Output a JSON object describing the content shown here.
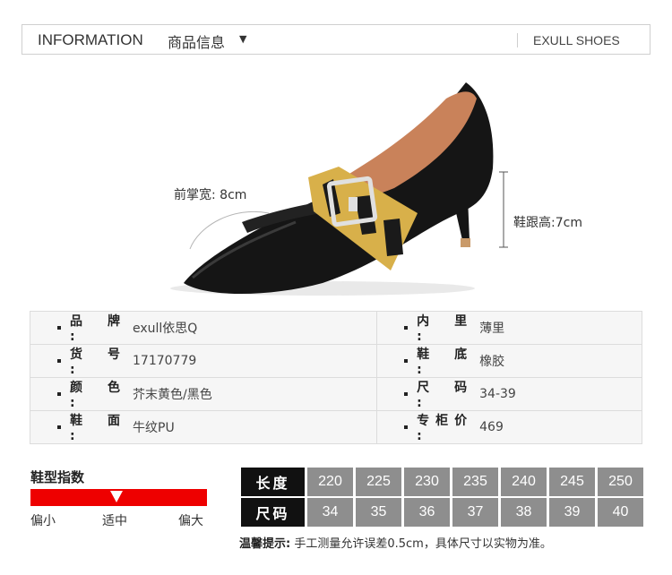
{
  "header": {
    "title_en": "INFORMATION",
    "title_cn": "商品信息",
    "caret": "▼",
    "brand": "EXULL SHOES"
  },
  "product": {
    "forefoot_label": "前掌宽: 8cm",
    "heel_label": "鞋跟高:7cm",
    "colors": {
      "leather": "#151515",
      "lining": "#c9825a",
      "buckle": "#d8b04a",
      "heel_tip": "#c99a6a"
    }
  },
  "info": {
    "rows": [
      {
        "left_key": "品 牌",
        "left_value": "exull依思Q",
        "right_key": "内 里",
        "right_value": "薄里"
      },
      {
        "left_key": "货 号",
        "left_value": "17170779",
        "right_key": "鞋 底",
        "right_value": "橡胶"
      },
      {
        "left_key": "颜 色",
        "left_value": "芥末黄色/黑色",
        "right_key": "尺 码",
        "right_value": "34-39"
      },
      {
        "left_key": "鞋 面",
        "left_value": "牛纹PU",
        "right_key": "专柜价",
        "right_value": "469"
      }
    ]
  },
  "index": {
    "title": "鞋型指数",
    "labels": [
      "偏小",
      "适中",
      "偏大"
    ],
    "bar_color": "#ee0000"
  },
  "size_table": {
    "length_header": "长度",
    "size_header": "尺码",
    "lengths": [
      "220",
      "225",
      "230",
      "235",
      "240",
      "245",
      "250"
    ],
    "sizes": [
      "34",
      "35",
      "36",
      "37",
      "38",
      "39",
      "40"
    ]
  },
  "tip": {
    "label": "温馨提示:",
    "text": "手工测量允许误差0.5cm，具体尺寸以实物为准。"
  }
}
